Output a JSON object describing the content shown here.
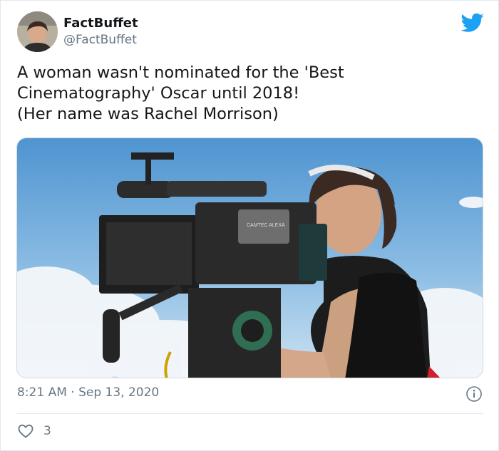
{
  "account": {
    "display_name": "FactBuffet",
    "handle": "@FactBuffet"
  },
  "tweet": {
    "text_lines": [
      "A woman wasn't nominated for the 'Best",
      "Cinematography' Oscar until 2018!",
      "(Her name was Rachel Morrison)"
    ],
    "timestamp": "8:21 AM · Sep 13, 2020",
    "like_count": "3"
  },
  "media": {
    "camera_brand_plate": "CAMTEC ALEXA"
  },
  "icons": {
    "brand": "twitter-bird-icon",
    "info": "info-icon",
    "like": "heart-icon"
  },
  "colors": {
    "twitter_blue": "#1da1f2",
    "secondary_text": "#657786",
    "primary_text": "#14171a"
  }
}
